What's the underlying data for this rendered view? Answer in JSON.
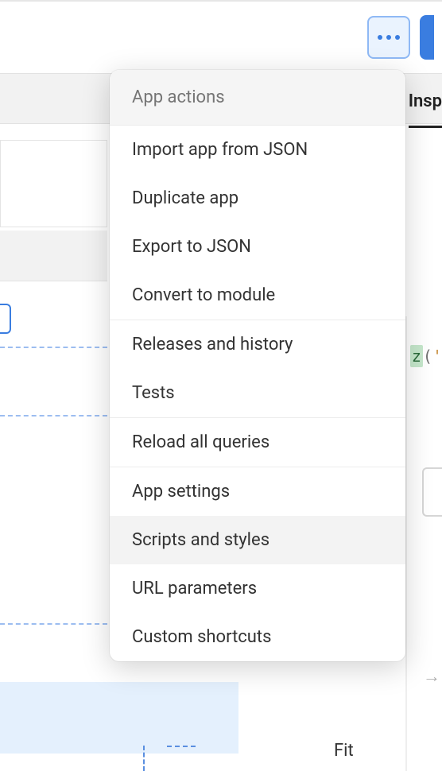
{
  "toolbar": {
    "more_btn": "more-options"
  },
  "right_panel": {
    "tab_inspect": "Insp",
    "code_z": "z",
    "code_paren": "(",
    "code_quote": "'",
    "arrow": "→",
    "fit_label": "Fit"
  },
  "menu": {
    "header": "App actions",
    "sections": [
      [
        "Import app from JSON",
        "Duplicate app",
        "Export to JSON",
        "Convert to module"
      ],
      [
        "Releases and history",
        "Tests"
      ],
      [
        "Reload all queries"
      ],
      [
        "App settings",
        "Scripts and styles",
        "URL parameters",
        "Custom shortcuts"
      ]
    ],
    "hovered": "Scripts and styles"
  }
}
